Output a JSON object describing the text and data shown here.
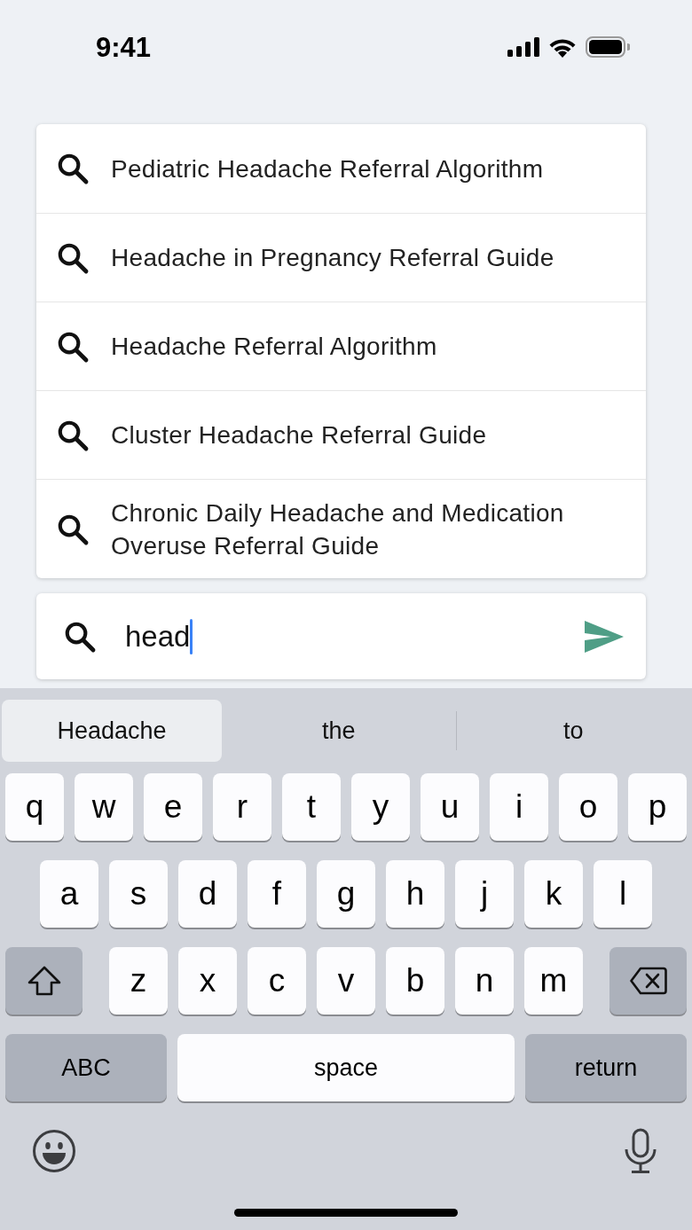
{
  "status_bar": {
    "time": "9:41"
  },
  "suggestions": [
    {
      "text": "Pediatric Headache Referral Algorithm"
    },
    {
      "text": "Headache in Pregnancy Referral Guide"
    },
    {
      "text": "Headache Referral Algorithm"
    },
    {
      "text": "Cluster Headache Referral Guide"
    },
    {
      "text": "Chronic Daily Headache and Medication Overuse Referral Guide"
    }
  ],
  "search": {
    "value": "head"
  },
  "keyboard": {
    "predictions": [
      {
        "text": "Headache",
        "selected": true
      },
      {
        "text": "the",
        "selected": false
      },
      {
        "text": "to",
        "selected": false
      }
    ],
    "letter_rows": [
      {
        "keys": [
          {
            "kind": "letter",
            "text": "q"
          },
          {
            "kind": "letter",
            "text": "w"
          },
          {
            "kind": "letter",
            "text": "e"
          },
          {
            "kind": "letter",
            "text": "r"
          },
          {
            "kind": "letter",
            "text": "t"
          },
          {
            "kind": "letter",
            "text": "y"
          },
          {
            "kind": "letter",
            "text": "u"
          },
          {
            "kind": "letter",
            "text": "i"
          },
          {
            "kind": "letter",
            "text": "o"
          },
          {
            "kind": "letter",
            "text": "p"
          }
        ]
      },
      {
        "keys": [
          {
            "kind": "letter",
            "text": "a"
          },
          {
            "kind": "letter",
            "text": "s"
          },
          {
            "kind": "letter",
            "text": "d"
          },
          {
            "kind": "letter",
            "text": "f"
          },
          {
            "kind": "letter",
            "text": "g"
          },
          {
            "kind": "letter",
            "text": "h"
          },
          {
            "kind": "letter",
            "text": "j"
          },
          {
            "kind": "letter",
            "text": "k"
          },
          {
            "kind": "letter",
            "text": "l"
          }
        ]
      },
      {
        "keys": [
          {
            "kind": "shift"
          },
          {
            "kind": "letter",
            "text": "z"
          },
          {
            "kind": "letter",
            "text": "x"
          },
          {
            "kind": "letter",
            "text": "c"
          },
          {
            "kind": "letter",
            "text": "v"
          },
          {
            "kind": "letter",
            "text": "b"
          },
          {
            "kind": "letter",
            "text": "n"
          },
          {
            "kind": "letter",
            "text": "m"
          },
          {
            "kind": "backspace"
          }
        ]
      }
    ],
    "bottom_keys": [
      {
        "kind": "mode",
        "text": "ABC"
      },
      {
        "kind": "space",
        "text": "space"
      },
      {
        "kind": "return",
        "text": "return"
      }
    ]
  }
}
